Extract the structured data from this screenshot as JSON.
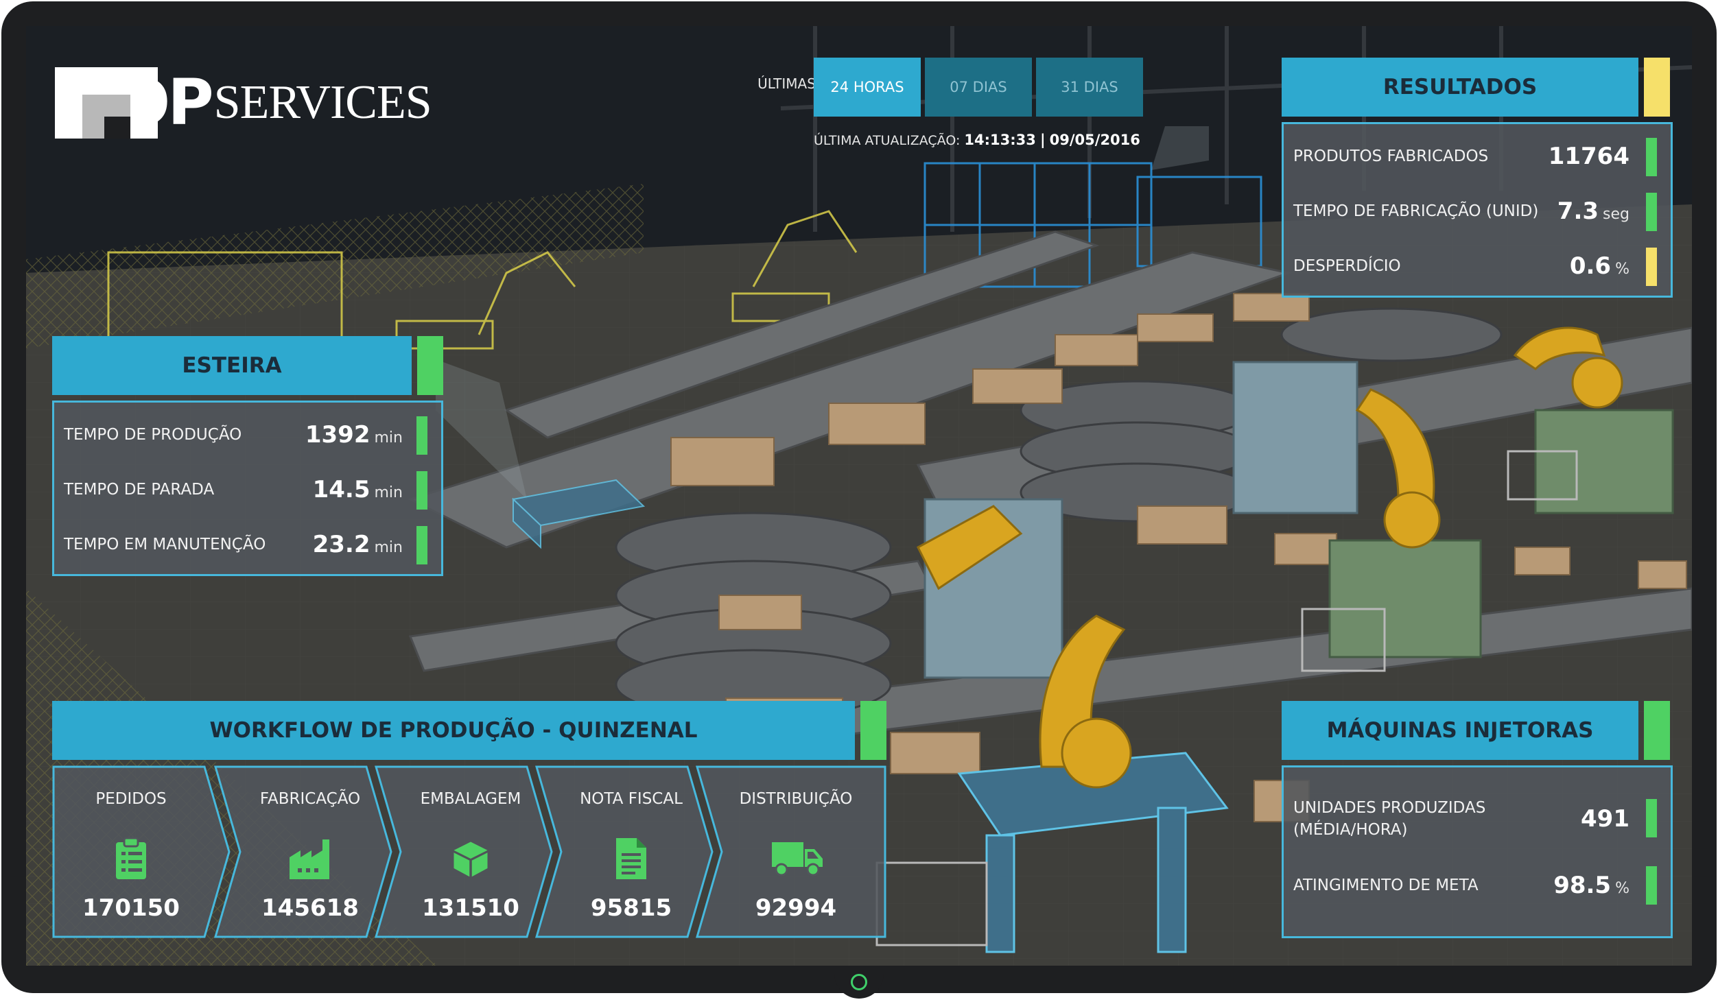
{
  "brand": {
    "logo_op": "OP",
    "logo_services": "SERVICES"
  },
  "filter": {
    "label": "ÚLTIMAS...",
    "options": [
      {
        "label": "24 HORAS",
        "active": true
      },
      {
        "label": "07 DIAS",
        "active": false
      },
      {
        "label": "31 DIAS",
        "active": false
      }
    ],
    "update_label": "ÚLTIMA ATUALIZAÇÃO:",
    "update_time": "14:13:33",
    "update_separator": "|",
    "update_date": "09/05/2016"
  },
  "esteira": {
    "title": "ESTEIRA",
    "rows": [
      {
        "label": "TEMPO DE PRODUÇÃO",
        "value": "1392",
        "unit": "min",
        "status_color": "#4fd163"
      },
      {
        "label": "TEMPO DE PARADA",
        "value": "14.5",
        "unit": "min",
        "status_color": "#4fd163"
      },
      {
        "label": "TEMPO EM MANUTENÇÃO",
        "value": "23.2",
        "unit": "min",
        "status_color": "#4fd163"
      }
    ]
  },
  "resultados": {
    "title": "RESULTADOS",
    "header_status_color": "#f6e06a",
    "rows": [
      {
        "label": "PRODUTOS FABRICADOS",
        "value": "11764",
        "unit": "",
        "status_color": "#4fd163"
      },
      {
        "label": "TEMPO DE FABRICAÇÃO (UNID)",
        "value": "7.3",
        "unit": "seg",
        "status_color": "#4fd163"
      },
      {
        "label": "DESPERDÍCIO",
        "value": "0.6",
        "unit": "%",
        "status_color": "#f6e06a"
      }
    ]
  },
  "workflow": {
    "title": "WORKFLOW DE PRODUÇÃO - QUINZENAL",
    "steps": [
      {
        "label": "PEDIDOS",
        "icon": "clipboard-icon",
        "value": "170150"
      },
      {
        "label": "FABRICAÇÃO",
        "icon": "factory-icon",
        "value": "145618"
      },
      {
        "label": "EMBALAGEM",
        "icon": "package-icon",
        "value": "131510"
      },
      {
        "label": "NOTA FISCAL",
        "icon": "document-icon",
        "value": "95815"
      },
      {
        "label": "DISTRIBUIÇÃO",
        "icon": "truck-icon",
        "value": "92994"
      }
    ]
  },
  "maquinas": {
    "title": "MÁQUINAS INJETORAS",
    "rows": [
      {
        "label_line1": "UNIDADES PRODUZIDAS",
        "label_line2": "(MÉDIA/HORA)",
        "value": "491",
        "unit": "",
        "status_color": "#4fd163"
      },
      {
        "label_line1": "ATINGIMENTO DE META",
        "label_line2": "",
        "value": "98.5",
        "unit": "%",
        "status_color": "#4fd163"
      }
    ]
  },
  "colors": {
    "accent_blue": "#2ea9cf",
    "ok_green": "#4fd163",
    "warn_yellow": "#f6e06a",
    "panel_border": "#47b8dc"
  }
}
